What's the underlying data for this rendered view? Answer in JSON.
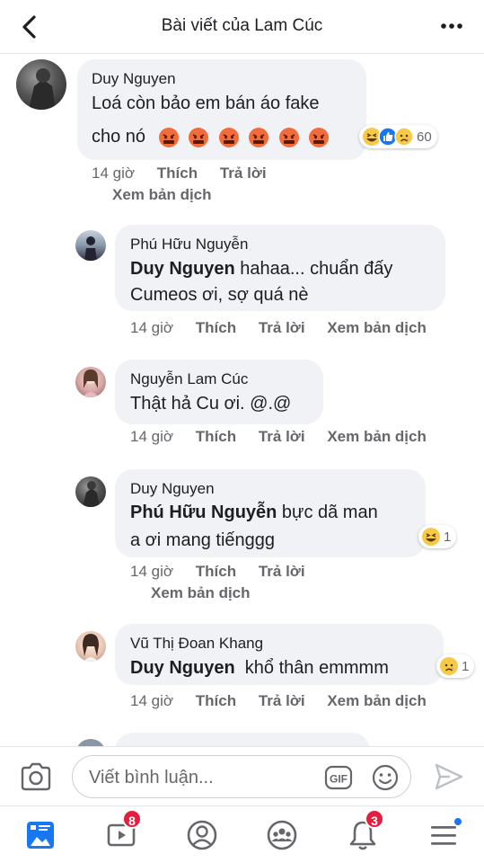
{
  "header": {
    "title": "Bài viết của Lam Cúc"
  },
  "comments": [
    {
      "author": "Duy Nguyen",
      "line1": "Loá còn bảo em bán áo fake",
      "line2": "cho nó",
      "emoji": "angry-face-icon",
      "emoji_count": 6,
      "reactions": [
        "haha",
        "like",
        "sad"
      ],
      "reaction_count": "60",
      "time": "14 giờ",
      "like": "Thích",
      "reply": "Trả lời",
      "translate": "Xem bản dịch"
    },
    {
      "author": "Phú Hữu Nguyễn",
      "mention": "Duy Nguyen",
      "line1": " hahaa... chuẩn đấy",
      "line2": "Cumeos ơi, sợ quá nè",
      "time": "14 giờ",
      "like": "Thích",
      "reply": "Trả lời",
      "translate": "Xem bản dịch"
    },
    {
      "author": "Nguyễn Lam Cúc",
      "line1": "Thật hả Cu ơi. @.@",
      "time": "14 giờ",
      "like": "Thích",
      "reply": "Trả lời",
      "translate": "Xem bản dịch"
    },
    {
      "author": "Duy Nguyen",
      "mention": "Phú Hữu Nguyễn",
      "line1": " bực dã man",
      "line2": "a ơi mang tiếnggg",
      "reactions": [
        "haha"
      ],
      "reaction_count": "1",
      "time": "14 giờ",
      "like": "Thích",
      "reply": "Trả lời",
      "translate": "Xem bản dịch"
    },
    {
      "author": "Vũ Thị Đoan Khang",
      "mention": "Duy Nguyen",
      "line1": "  khổ thân emmmm",
      "reactions": [
        "sad"
      ],
      "reaction_count": "1",
      "time": "14 giờ",
      "like": "Thích",
      "reply": "Trả lời",
      "translate": "Xem bản dịch"
    }
  ],
  "composer": {
    "placeholder": "Viết bình luận...",
    "gif_label": "GIF"
  },
  "nav": {
    "watch_badge": "8",
    "notifications_badge": "3"
  },
  "colors": {
    "brand_blue": "#1877f2",
    "badge_red": "#e41e3f",
    "bubble_gray": "#f0f2f5",
    "meta_gray": "#65676b"
  }
}
